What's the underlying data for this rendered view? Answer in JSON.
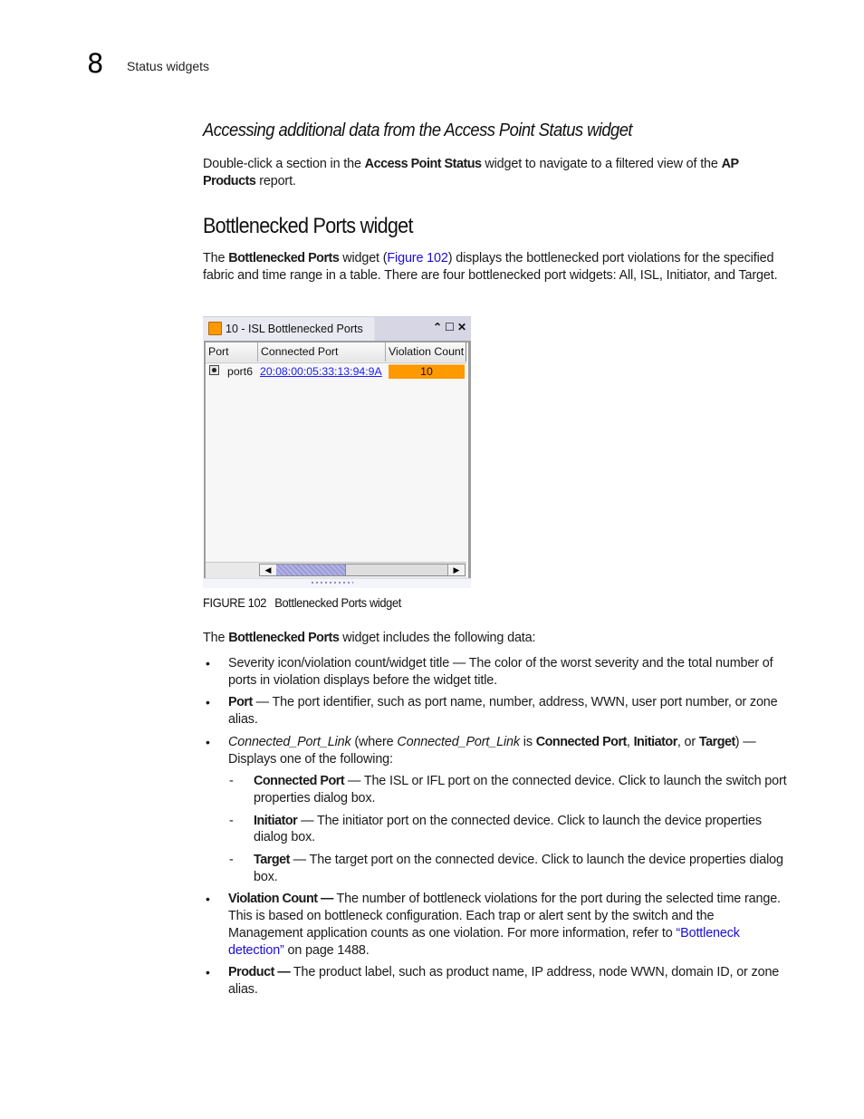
{
  "header": {
    "chapter_number": "8",
    "running_head": "Status widgets"
  },
  "section1": {
    "heading": "Accessing additional data from the Access Point Status widget",
    "para": {
      "t1": "Double-click a section in the ",
      "b1": "Access Point Status",
      "t2": " widget to navigate to a filtered view of the ",
      "b2": "AP Products",
      "t3": " report."
    }
  },
  "section2": {
    "heading": "Bottlenecked Ports widget",
    "intro": {
      "t1": "The ",
      "b1": "Bottlenecked Ports",
      "t2": " widget (",
      "link": "Figure 102",
      "t3": ") displays the bottlenecked port violations for the specified fabric and time range in a table. There are four bottlenecked port widgets: All, ISL, Initiator, and Target."
    }
  },
  "widget": {
    "title": "10 - ISL Bottlenecked Ports",
    "severity_color": "#ff9900",
    "icons": {
      "collapse": "⌃",
      "maximize": "☐",
      "close": "✕"
    },
    "columns": [
      "Port",
      "Connected Port",
      "Violation Count"
    ],
    "rows": [
      {
        "port": "port6",
        "connected_port": "20:08:00:05:33:13:94:9A",
        "violation_count": "10"
      }
    ],
    "scroll": {
      "left": "◀",
      "right": "▶"
    }
  },
  "figure": {
    "number": "FIGURE 102",
    "caption": "Bottlenecked Ports widget"
  },
  "section3": {
    "intro": {
      "t1": "The ",
      "b1": "Bottlenecked Ports",
      "t2": " widget includes the following data:"
    },
    "bullets": [
      {
        "text": "Severity icon/violation count/widget title — The color of the worst severity and the total number of ports in violation displays before the widget title."
      },
      {
        "bold": "Port",
        "text": " — The port identifier, such as port name, number, address, WWN, user port number, or zone alias."
      },
      {
        "i1": "Connected_Port_Link",
        "t1": " (where ",
        "i2": "Connected_Port_Link",
        "t2": " is ",
        "b1": "Connected Port",
        "t3": ", ",
        "b2": "Initiator",
        "t4": ", or ",
        "b3": "Target",
        "t5": ") — Displays one of the following:",
        "sub": [
          {
            "bold": "Connected Port",
            "text": " — The ISL or IFL port on the connected device. Click to launch the switch port properties dialog box."
          },
          {
            "bold": "Initiator",
            "text": " — The initiator port on the connected device. Click to launch the device properties dialog box."
          },
          {
            "bold": "Target",
            "text": " — The target port on the connected device. Click to launch the device properties dialog box."
          }
        ]
      },
      {
        "bold": "Violation Count —",
        "text": " The number of bottleneck violations for the port during the selected time range. This is based on bottleneck configuration. Each trap or alert sent by the switch and the Management application counts as one violation. For more information, refer to ",
        "link": "“Bottleneck detection”",
        "text2": " on page 1488."
      },
      {
        "bold": "Product —",
        "text": " The product label, such as product name, IP address, node WWN, domain ID, or zone alias."
      }
    ],
    "bullet_glyph": "•",
    "dash_glyph": "-"
  }
}
